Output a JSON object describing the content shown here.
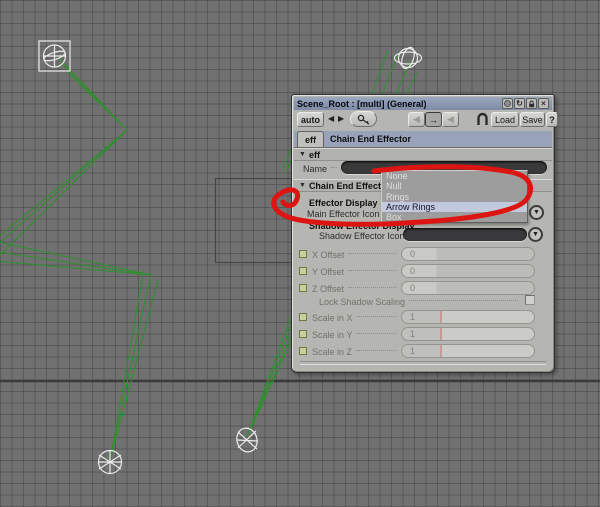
{
  "window": {
    "title": "Scene_Root : [multi] (General)"
  },
  "toolbar": {
    "auto_label": "auto",
    "prev_arrow": "◀",
    "next_arrow": "▶",
    "nav_back": "◀",
    "nav_current": "→",
    "nav_forward": "◀",
    "load_label": "Load",
    "save_label": "Save",
    "help_label": "?"
  },
  "tabs": {
    "tab_label": "eff",
    "header_label": "Chain End Effector"
  },
  "sections": {
    "collapse_glyph": "▼",
    "eff_label": "eff",
    "chain_label": "Chain End Effector",
    "effector_display_label": "Effector Display",
    "shadow_display_label": "Shadow Effector Display"
  },
  "fields": {
    "name_label": "Name",
    "name_value": "",
    "main_icon_label": "Main Effector Icon",
    "shadow_icon_label": "Shadow Effector Icon",
    "lock_label": "Lock Shadow Scaling",
    "dropdown_glyph": "▼",
    "offsets": [
      {
        "label": "X Offset",
        "value": "0"
      },
      {
        "label": "Y Offset",
        "value": "0"
      },
      {
        "label": "Z Offset",
        "value": "0"
      }
    ],
    "scales": [
      {
        "label": "Scale in X",
        "value": "1"
      },
      {
        "label": "Scale in Y",
        "value": "1"
      },
      {
        "label": "Scale in Z",
        "value": "1"
      }
    ]
  },
  "dropdown": {
    "items": [
      "None",
      "Null",
      "Rings",
      "Arrow Rings",
      "Box"
    ],
    "selected": "Arrow Rings"
  },
  "titlebar_icons": {
    "close_glyph": "×",
    "recycle_glyph": "↻"
  },
  "colors": {
    "chain_green": "#2f8f2f",
    "annotation_red": "#dd1512",
    "selection_blue": "#c3c9dd",
    "titlebar_blue": "#8c99b2",
    "panel_gray": "#b5b5b1",
    "viewport_gray": "#717171"
  }
}
